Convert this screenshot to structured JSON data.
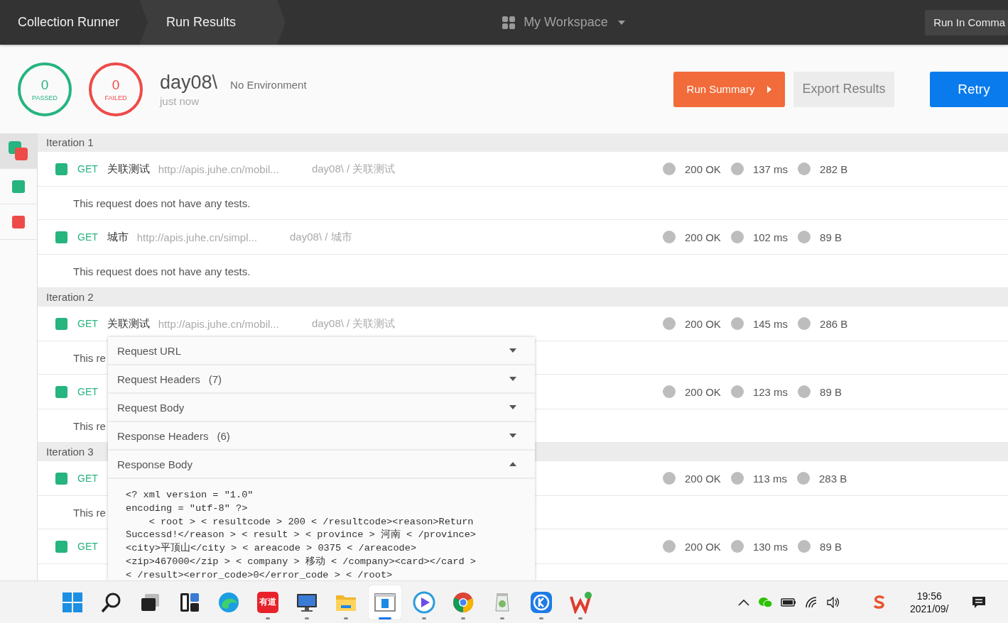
{
  "topbar": {
    "breadcrumbs": [
      {
        "label": "Collection Runner",
        "selected": false
      },
      {
        "label": "Run Results",
        "selected": true
      }
    ],
    "workspace": "My Workspace",
    "command_button": "Run In Comma"
  },
  "summary": {
    "passed": {
      "count": "0",
      "label": "PASSED"
    },
    "failed": {
      "count": "0",
      "label": "FAILED"
    },
    "collection": "day08\\",
    "environment": "No Environment",
    "time": "just now",
    "buttons": [
      {
        "label": "Run Summary",
        "kind": "summary"
      },
      {
        "label": "Export Results",
        "kind": "export"
      },
      {
        "label": "Retry",
        "kind": "retry"
      }
    ]
  },
  "sidebar": [
    {
      "kind": "mixed",
      "selected": true
    },
    {
      "kind": "passed",
      "selected": false
    },
    {
      "kind": "failed",
      "selected": false
    }
  ],
  "iterations": [
    {
      "title": "Iteration 1",
      "requests": [
        {
          "passed": true,
          "method": "GET",
          "name": "关联测试",
          "url": "http://apis.juhe.cn/mobil...",
          "path": "day08\\ / 关联测试",
          "status": "200 OK",
          "time": "137 ms",
          "size": "282 B",
          "note": "This request does not have any tests."
        },
        {
          "passed": true,
          "method": "GET",
          "name": "城市",
          "url": "http://apis.juhe.cn/simpl...",
          "path": "day08\\ / 城市",
          "status": "200 OK",
          "time": "102 ms",
          "size": "89 B",
          "note": "This request does not have any tests."
        }
      ]
    },
    {
      "title": "Iteration 2",
      "requests": [
        {
          "passed": true,
          "method": "GET",
          "name": "关联测试",
          "url": "http://apis.juhe.cn/mobil...",
          "path": "day08\\ / 关联测试",
          "status": "200 OK",
          "time": "145 ms",
          "size": "286 B",
          "note": "This re"
        },
        {
          "passed": true,
          "method": "GET",
          "status": "200 OK",
          "time": "123 ms",
          "size": "89 B",
          "note": "This re"
        }
      ]
    },
    {
      "title": "Iteration 3",
      "requests": [
        {
          "passed": true,
          "method": "GET",
          "status": "200 OK",
          "time": "113 ms",
          "size": "283 B",
          "note": "This re"
        },
        {
          "passed": true,
          "method": "GET",
          "status": "200 OK",
          "time": "130 ms",
          "size": "89 B"
        }
      ]
    }
  ],
  "details_popup": {
    "sections": [
      {
        "title": "Request URL",
        "expanded": false
      },
      {
        "title": "Request Headers",
        "count": "(7)",
        "expanded": false
      },
      {
        "title": "Request Body",
        "expanded": false
      },
      {
        "title": "Response Headers",
        "count": "(6)",
        "expanded": false
      },
      {
        "title": "Response Body",
        "expanded": true,
        "content": "<? xml version = \"1.0\"\nencoding = \"utf-8\" ?>\n    < root > < resultcode > 200 < /resultcode><reason>Return\nSuccessd!</reason > < result > < province > 河南 < /province>\n<city>平顶山</city > < areacode > 0375 < /areacode>\n<zip>467000</zip > < company > 移动 < /company><card></card >\n< /result><error_code>0</error_code > < /root>"
      }
    ]
  },
  "taskbar": {
    "apps": [
      {
        "kind": "start",
        "running": false,
        "selected": false
      },
      {
        "kind": "search",
        "running": false,
        "selected": false
      },
      {
        "kind": "task-view",
        "running": false,
        "selected": false
      },
      {
        "kind": "widgets",
        "running": false,
        "selected": false
      },
      {
        "kind": "edge",
        "running": false,
        "selected": false
      },
      {
        "kind": "youdao",
        "label": "有道",
        "running": true,
        "selected": false
      },
      {
        "kind": "monitor",
        "running": true,
        "selected": false
      },
      {
        "kind": "folder",
        "running": true,
        "selected": false
      },
      {
        "kind": "window",
        "running": true,
        "selected": true
      },
      {
        "kind": "player",
        "running": true,
        "selected": false
      },
      {
        "kind": "chrome",
        "running": true,
        "selected": false
      },
      {
        "kind": "jar",
        "running": true,
        "selected": false
      },
      {
        "kind": "k-app",
        "running": true,
        "selected": false
      },
      {
        "kind": "wps",
        "running": true,
        "selected": false
      }
    ],
    "time": "19:56",
    "date": "2021/09/"
  }
}
